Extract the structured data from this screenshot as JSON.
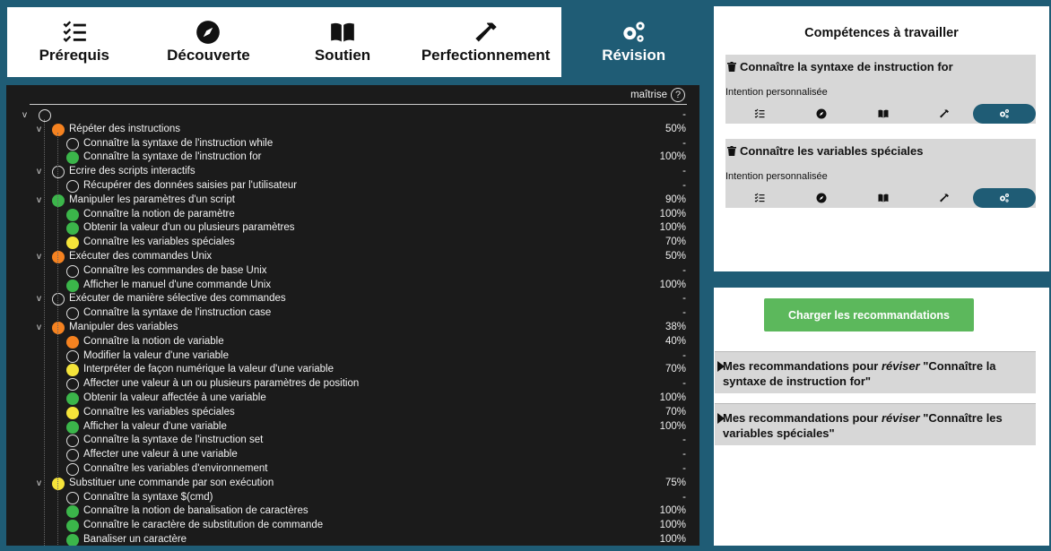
{
  "tabs": [
    {
      "label": "Prérequis",
      "icon": "checklist-icon",
      "active": false
    },
    {
      "label": "Découverte",
      "icon": "compass-icon",
      "active": false
    },
    {
      "label": "Soutien",
      "icon": "book-icon",
      "active": false
    },
    {
      "label": "Perfectionnement",
      "icon": "hammer-icon",
      "active": false
    },
    {
      "label": "Révision",
      "icon": "gears-icon",
      "active": true
    }
  ],
  "tree": {
    "mastery_label": "maîtrise",
    "help_symbol": "?",
    "rows": [
      {
        "level": 0,
        "toggle": "v",
        "status": "empty",
        "label": "",
        "pct": "-"
      },
      {
        "level": 1,
        "toggle": "v",
        "status": "orange",
        "label": "Répéter des instructions",
        "pct": "50%"
      },
      {
        "level": 2,
        "toggle": "",
        "status": "empty",
        "label": "Connaître la syntaxe de l'instruction while",
        "pct": "-"
      },
      {
        "level": 2,
        "toggle": "",
        "status": "green",
        "label": "Connaître la syntaxe de l'instruction for",
        "pct": "100%"
      },
      {
        "level": 1,
        "toggle": "v",
        "status": "empty",
        "label": "Ecrire des scripts interactifs",
        "pct": "-"
      },
      {
        "level": 2,
        "toggle": "",
        "status": "empty",
        "label": "Récupérer des données saisies par l'utilisateur",
        "pct": "-"
      },
      {
        "level": 1,
        "toggle": "v",
        "status": "green",
        "label": "Manipuler les paramètres d'un script",
        "pct": "90%"
      },
      {
        "level": 2,
        "toggle": "",
        "status": "green",
        "label": "Connaître la notion de paramètre",
        "pct": "100%"
      },
      {
        "level": 2,
        "toggle": "",
        "status": "green",
        "label": "Obtenir la valeur d'un ou plusieurs paramètres",
        "pct": "100%"
      },
      {
        "level": 2,
        "toggle": "",
        "status": "yellow",
        "label": "Connaître les variables spéciales",
        "pct": "70%"
      },
      {
        "level": 1,
        "toggle": "v",
        "status": "orange",
        "label": "Exécuter des commandes Unix",
        "pct": "50%"
      },
      {
        "level": 2,
        "toggle": "",
        "status": "empty",
        "label": "Connaître les commandes de base Unix",
        "pct": "-"
      },
      {
        "level": 2,
        "toggle": "",
        "status": "green",
        "label": "Afficher le manuel d'une commande Unix",
        "pct": "100%"
      },
      {
        "level": 1,
        "toggle": "v",
        "status": "half",
        "label": "Exécuter de manière sélective des commandes",
        "pct": "-"
      },
      {
        "level": 2,
        "toggle": "",
        "status": "empty",
        "label": "Connaître la syntaxe de l'instruction case",
        "pct": "-"
      },
      {
        "level": 1,
        "toggle": "v",
        "status": "orange",
        "label": "Manipuler des variables",
        "pct": "38%"
      },
      {
        "level": 2,
        "toggle": "",
        "status": "orange",
        "label": "Connaître la notion de variable",
        "pct": "40%"
      },
      {
        "level": 2,
        "toggle": "",
        "status": "empty",
        "label": "Modifier la valeur d'une variable",
        "pct": "-"
      },
      {
        "level": 2,
        "toggle": "",
        "status": "yellow",
        "label": "Interpréter de façon numérique la valeur d'une variable",
        "pct": "70%"
      },
      {
        "level": 2,
        "toggle": "",
        "status": "empty",
        "label": "Affecter une valeur à un ou plusieurs paramètres de position",
        "pct": "-"
      },
      {
        "level": 2,
        "toggle": "",
        "status": "green",
        "label": "Obtenir la valeur affectée à une variable",
        "pct": "100%"
      },
      {
        "level": 2,
        "toggle": "",
        "status": "yellow",
        "label": "Connaître les variables spéciales",
        "pct": "70%"
      },
      {
        "level": 2,
        "toggle": "",
        "status": "green",
        "label": "Afficher la valeur d'une variable",
        "pct": "100%"
      },
      {
        "level": 2,
        "toggle": "",
        "status": "empty",
        "label": "Connaître la syntaxe de l'instruction set",
        "pct": "-"
      },
      {
        "level": 2,
        "toggle": "",
        "status": "empty",
        "label": "Affecter une valeur à une variable",
        "pct": "-"
      },
      {
        "level": 2,
        "toggle": "",
        "status": "empty",
        "label": "Connaître les variables d'environnement",
        "pct": "-"
      },
      {
        "level": 1,
        "toggle": "v",
        "status": "yellow",
        "label": "Substituer une commande par son exécution",
        "pct": "75%"
      },
      {
        "level": 2,
        "toggle": "",
        "status": "empty",
        "label": "Connaître la syntaxe $(cmd)",
        "pct": "-"
      },
      {
        "level": 2,
        "toggle": "",
        "status": "green",
        "label": "Connaître la notion de banalisation de caractères",
        "pct": "100%"
      },
      {
        "level": 2,
        "toggle": "",
        "status": "green",
        "label": "Connaître le caractère de substitution de commande",
        "pct": "100%"
      },
      {
        "level": 2,
        "toggle": "",
        "status": "green",
        "label": "Banaliser un caractère",
        "pct": "100%"
      }
    ]
  },
  "skills_panel": {
    "title": "Compétences à travailler",
    "cards": [
      {
        "title": "Connaître la syntaxe de instruction for",
        "intent": "Intention personnalisée"
      },
      {
        "title": "Connaître les variables spéciales",
        "intent": "Intention personnalisée"
      }
    ]
  },
  "reco_panel": {
    "load_button": "Charger les recommandations",
    "items": [
      {
        "prefix": "Mes recommandations pour ",
        "verb": "réviser",
        "subject": " \"Connaître la syntaxe de instruction for\""
      },
      {
        "prefix": "Mes recommandations pour ",
        "verb": "réviser",
        "subject": " \"Connaître les variables spéciales\""
      }
    ]
  },
  "colors": {
    "accent": "#1f5c75",
    "status_orange": "#f58220",
    "status_green": "#3bb54a",
    "status_yellow": "#f5e43a",
    "button_green": "#5cb85c"
  }
}
